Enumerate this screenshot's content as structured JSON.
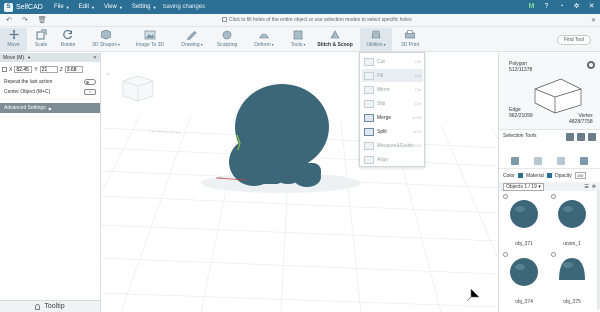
{
  "app": {
    "name": "SelfCAD",
    "status": "Saving changes",
    "badge": "M"
  },
  "menu": [
    {
      "label": "File"
    },
    {
      "label": "Edit"
    },
    {
      "label": "View"
    },
    {
      "label": "Setting"
    }
  ],
  "hint": {
    "text": "Click to fill holes of the entire object or use selection modes to select specific holes"
  },
  "toolbar": {
    "tools": [
      {
        "label": "Move"
      },
      {
        "label": "Scale"
      },
      {
        "label": "Rotate"
      },
      {
        "label": "3D Shapes"
      },
      {
        "label": "Image To 3D"
      },
      {
        "label": "Drawing"
      },
      {
        "label": "Sculpting"
      },
      {
        "label": "Deform"
      },
      {
        "label": "Tools"
      },
      {
        "label": "Stitch & Scoop"
      },
      {
        "label": "Utilities"
      },
      {
        "label": "3D Print"
      }
    ],
    "find_tool": "Find Tool"
  },
  "move_panel": {
    "title": "Move (M)",
    "x_label": "X",
    "x_value": "82.45",
    "y_label": "Y",
    "y_value": "21",
    "z_label": "Z",
    "z_value": "3.68",
    "repeat_label": "Repeat the last action",
    "center_label": "Center Object (M+C)",
    "advanced_label": "Advanced Settings",
    "tooltip_label": "Tooltip"
  },
  "utilities_menu": [
    {
      "label": "Cut",
      "key": "Ctrl",
      "enabled": false,
      "selected": false
    },
    {
      "label": "Fill",
      "key": "Ctrl",
      "enabled": false,
      "selected": true
    },
    {
      "label": "Mirror",
      "key": "Ctrl",
      "enabled": false,
      "selected": false
    },
    {
      "label": "Slip",
      "key": "Ctrl",
      "enabled": false,
      "selected": false
    },
    {
      "label": "Merge",
      "key": "U+M",
      "enabled": true,
      "selected": false
    },
    {
      "label": "Split",
      "key": "U+S",
      "enabled": true,
      "selected": false
    },
    {
      "label": "Measure&Guide",
      "key": "U+D",
      "enabled": false,
      "selected": false
    },
    {
      "label": "Align",
      "key": "",
      "enabled": false,
      "selected": false
    }
  ],
  "stats": {
    "polygon_label": "Polygon",
    "polygon_value": "512/11378",
    "edge_label": "Edge",
    "edge_value": "962/21099",
    "vertex_label": "Vertex",
    "vertex_value": "4828/7758"
  },
  "selection": {
    "title": "Selection Tools",
    "color_label": "Color",
    "material_label": "Material",
    "opacity_label": "Opacity",
    "opacity_value": "100",
    "color_hex": "#2d6f8f"
  },
  "objects": {
    "header": "Objects",
    "count": "1 / 19",
    "items": [
      {
        "name": "obj_371"
      },
      {
        "name": "union_1"
      },
      {
        "name": "obj_374"
      },
      {
        "name": "obj_375"
      }
    ]
  },
  "colors": {
    "brand": "#2b6f95",
    "model": "#3b6779"
  }
}
